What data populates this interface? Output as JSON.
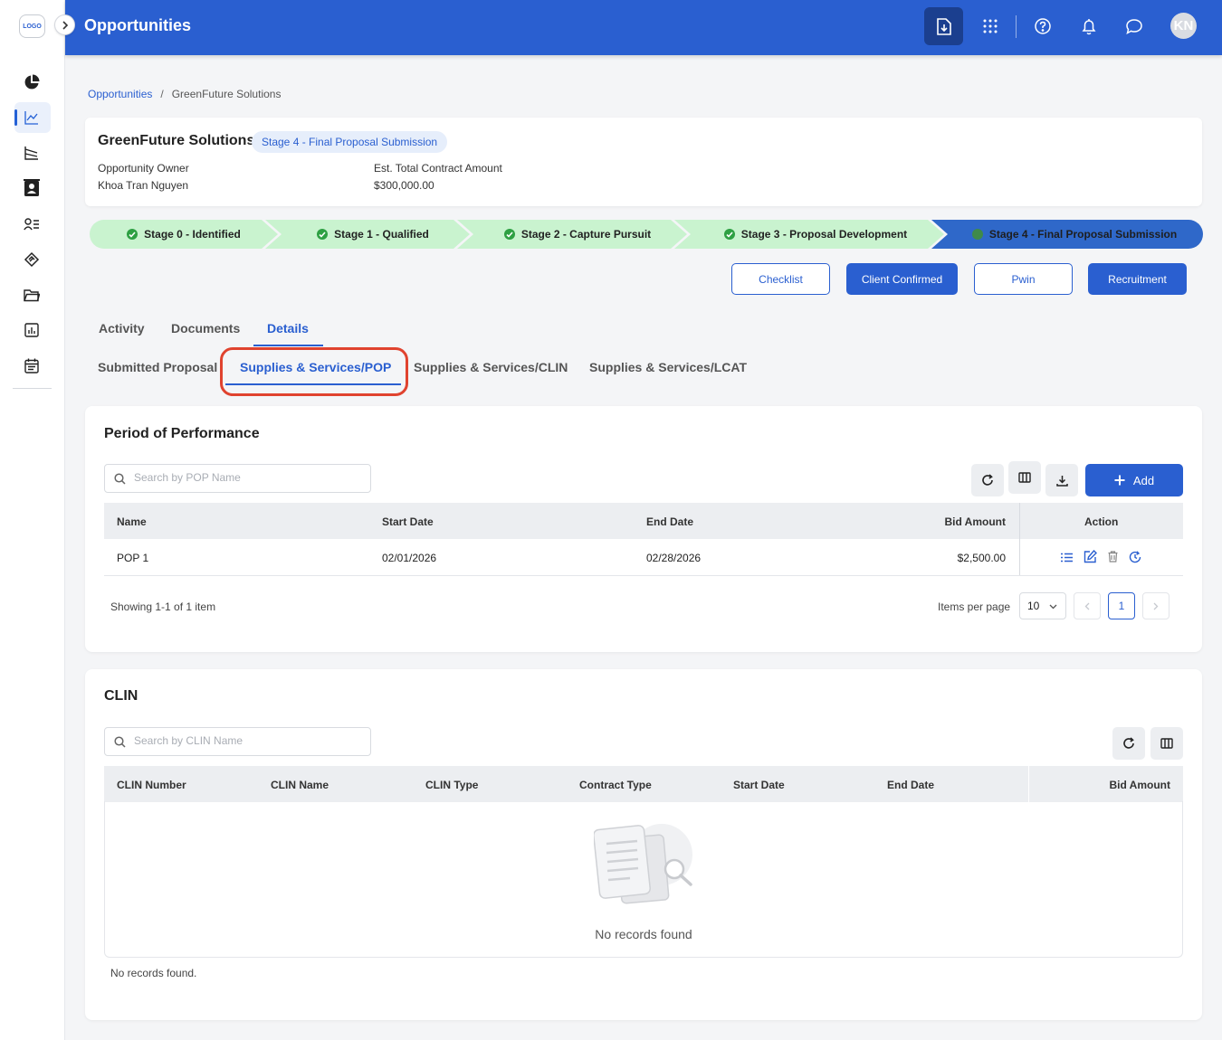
{
  "sidebar": {
    "logo_text": "LOGO",
    "icons": [
      "pie-chart-icon",
      "trend-chart-icon",
      "line-chart-icon",
      "contact-card-icon",
      "user-list-icon",
      "handshake-icon",
      "folder-icon",
      "bar-report-icon",
      "calendar-icon"
    ],
    "active_index": 1
  },
  "header": {
    "title": "Opportunities",
    "avatar_initials": "KN",
    "bg_color": "#2a5fd0"
  },
  "breadcrumb": {
    "root": "Opportunities",
    "separator": "/",
    "current": "GreenFuture Solutions"
  },
  "opportunity": {
    "name": "GreenFuture Solutions",
    "stage_badge": "Stage 4 - Final Proposal Submission",
    "owner_label": "Opportunity Owner",
    "owner_value": "Khoa Tran Nguyen",
    "amount_label": "Est. Total Contract Amount",
    "amount_value": "$300,000.00"
  },
  "stages": [
    {
      "label": "Stage 0 - Identified",
      "status": "done"
    },
    {
      "label": "Stage 1 - Qualified",
      "status": "done"
    },
    {
      "label": "Stage 2 - Capture Pursuit",
      "status": "done"
    },
    {
      "label": "Stage 3 - Proposal Development",
      "status": "done"
    },
    {
      "label": "Stage 4 - Final Proposal Submission",
      "status": "current"
    }
  ],
  "actions": {
    "checklist": "Checklist",
    "client_confirmed": "Client Confirmed",
    "pwin": "Pwin",
    "recruitment": "Recruitment"
  },
  "tabs": {
    "activity": "Activity",
    "documents": "Documents",
    "details": "Details"
  },
  "subtabs": {
    "submitted": "Submitted Proposal",
    "pop": "Supplies & Services/POP",
    "clin": "Supplies & Services/CLIN",
    "lcat": "Supplies & Services/LCAT"
  },
  "pop": {
    "title": "Period of Performance",
    "search_placeholder": "Search by POP Name",
    "add_label": "Add",
    "columns": {
      "name": "Name",
      "start": "Start Date",
      "end": "End Date",
      "bid": "Bid Amount",
      "action": "Action"
    },
    "rows": [
      {
        "name": "POP 1",
        "start": "02/01/2026",
        "end": "02/28/2026",
        "bid": "$2,500.00"
      }
    ],
    "showing": "Showing 1-1 of 1 item",
    "items_per_page_label": "Items per page",
    "items_per_page": "10",
    "current_page": "1"
  },
  "clin": {
    "title": "CLIN",
    "search_placeholder": "Search by CLIN Name",
    "columns": {
      "number": "CLIN Number",
      "name": "CLIN Name",
      "type": "CLIN Type",
      "contract": "Contract Type",
      "start": "Start Date",
      "end": "End Date",
      "bid": "Bid Amount"
    },
    "empty_text": "No records found",
    "footer_text": "No records found."
  },
  "colors": {
    "primary": "#2a5fd0",
    "stage_done": "#c9f3cf",
    "stage_current": "#2f68c9",
    "highlight": "#e0432f"
  }
}
